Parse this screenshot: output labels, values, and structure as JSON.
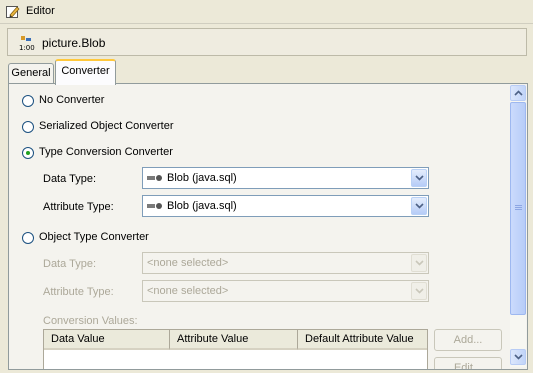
{
  "window": {
    "title": "Editor"
  },
  "header": {
    "title": "picture.Blob",
    "icon": "blob-mapping-icon"
  },
  "tabs": [
    {
      "label": "General",
      "selected": false
    },
    {
      "label": "Converter",
      "selected": true
    }
  ],
  "converter_options": [
    {
      "label": "No Converter",
      "checked": false
    },
    {
      "label": "Serialized Object Converter",
      "checked": false
    },
    {
      "label": "Type Conversion Converter",
      "checked": true
    },
    {
      "label": "Object Type Converter",
      "checked": false
    }
  ],
  "type_conversion": {
    "data_type_label": "Data Type:",
    "data_type_value": "Blob (java.sql)",
    "attribute_type_label": "Attribute Type:",
    "attribute_type_value": "Blob (java.sql)"
  },
  "object_type": {
    "data_type_label": "Data Type:",
    "data_type_value": "<none selected>",
    "attribute_type_label": "Attribute Type:",
    "attribute_type_value": "<none selected>",
    "conversion_values_label": "Conversion Values:",
    "columns": [
      "Data Value",
      "Attribute Value",
      "Default Attribute Value"
    ],
    "add_label": "Add...",
    "edit_label": "Edit..."
  }
}
